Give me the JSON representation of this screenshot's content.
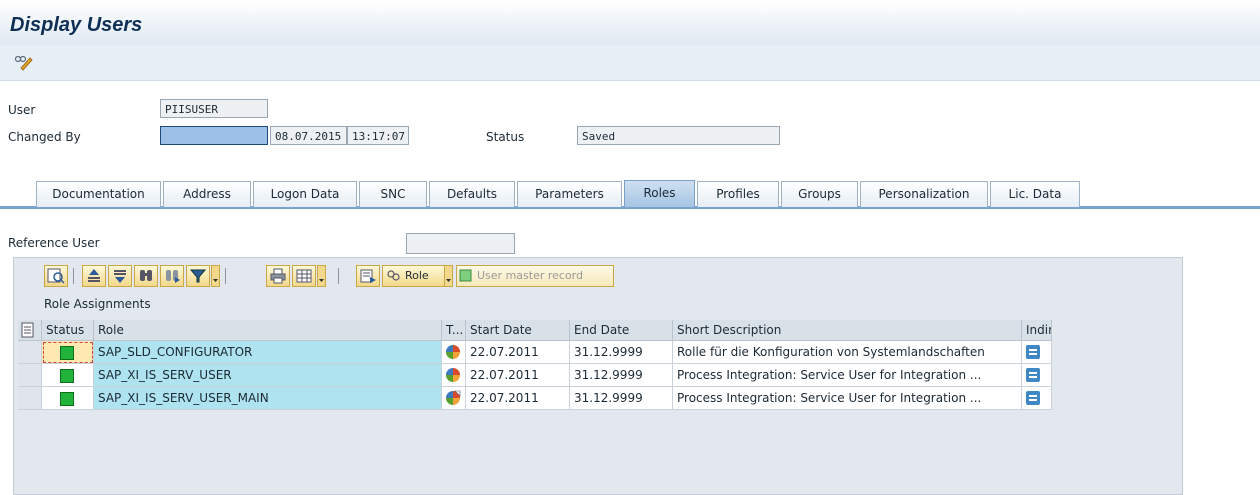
{
  "window": {
    "title": "Display Users"
  },
  "header_fields": {
    "user_label": "User",
    "user_value": "PIISUSER",
    "changed_by_label": "Changed By",
    "changed_by_value": "",
    "changed_date": "08.07.2015",
    "changed_time": "13:17:07",
    "status_label": "Status",
    "status_value": "Saved"
  },
  "tabs": [
    {
      "label": "Documentation"
    },
    {
      "label": "Address"
    },
    {
      "label": "Logon Data"
    },
    {
      "label": "SNC"
    },
    {
      "label": "Defaults"
    },
    {
      "label": "Parameters"
    },
    {
      "label": "Roles",
      "active": true
    },
    {
      "label": "Profiles"
    },
    {
      "label": "Groups"
    },
    {
      "label": "Personalization"
    },
    {
      "label": "Lic. Data"
    }
  ],
  "reference_user": {
    "label": "Reference User",
    "value": ""
  },
  "grid_toolbar": {
    "role_button": "Role",
    "user_master_button": "User master record"
  },
  "role_assignments": {
    "title": "Role Assignments",
    "columns": [
      "Status",
      "Role",
      "T...",
      "Start Date",
      "End Date",
      "Short Description",
      "Indir..."
    ],
    "rows": [
      {
        "role": "SAP_SLD_CONFIGURATOR",
        "start": "22.07.2011",
        "end": "31.12.9999",
        "desc": "Rolle für die Konfiguration von Systemlandschaften"
      },
      {
        "role": "SAP_XI_IS_SERV_USER",
        "start": "22.07.2011",
        "end": "31.12.9999",
        "desc": "Process Integration: Service User for Integration ..."
      },
      {
        "role": "SAP_XI_IS_SERV_USER_MAIN",
        "start": "22.07.2011",
        "end": "31.12.9999",
        "desc": "Process Integration: Service User for Integration ..."
      }
    ]
  },
  "colors": {
    "accent": "#7aa3d0",
    "role_cell": "#aee3ef",
    "status_ok": "#22b33a"
  }
}
